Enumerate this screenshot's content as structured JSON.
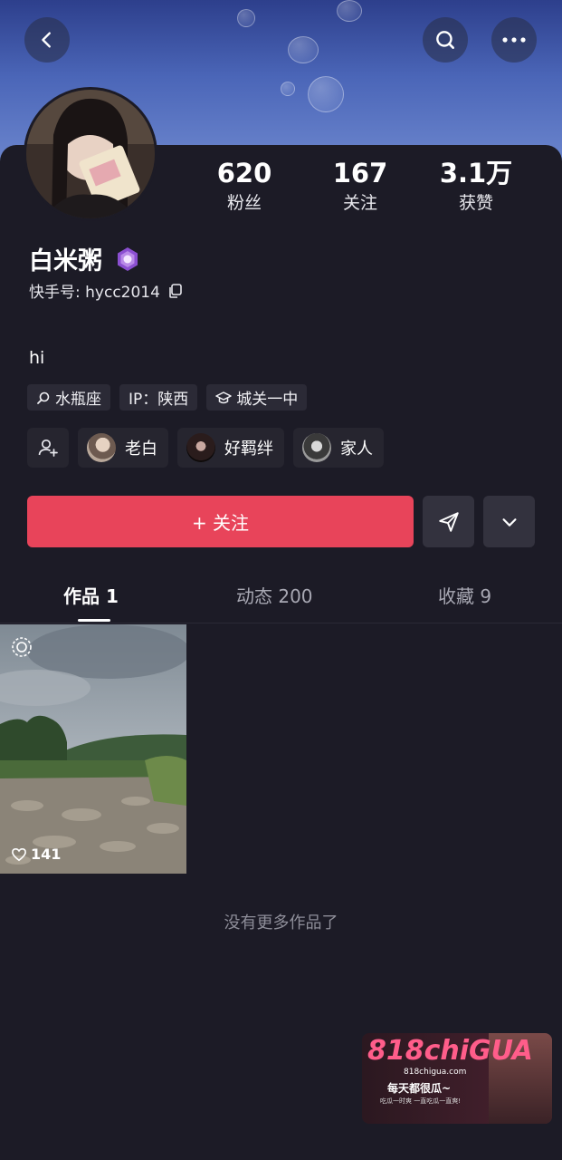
{
  "profile": {
    "name": "白米粥",
    "user_id": "快手号: hycc2014",
    "bio": "hi"
  },
  "stats": [
    {
      "value": "620",
      "label": "粉丝"
    },
    {
      "value": "167",
      "label": "关注"
    },
    {
      "value": "3.1万",
      "label": "获赞"
    }
  ],
  "tags": [
    {
      "icon": "search-icon",
      "label": "水瓶座"
    },
    {
      "icon": "",
      "label": "IP：陕西"
    },
    {
      "icon": "graduation-cap-icon",
      "label": "城关一中"
    }
  ],
  "friends": [
    {
      "name": "老白"
    },
    {
      "name": "好羁绊"
    },
    {
      "name": "家人"
    }
  ],
  "actions": {
    "follow_label": "+ 关注"
  },
  "tabs": [
    {
      "label": "作品 1",
      "active": true
    },
    {
      "label": "动态 200",
      "active": false
    },
    {
      "label": "收藏 9",
      "active": false
    }
  ],
  "works": [
    {
      "likes": "141"
    }
  ],
  "footer": {
    "no_more": "没有更多作品了"
  },
  "watermark": {
    "logo": "818chiGUA",
    "site": "818chigua.com",
    "slogan": "每天都很瓜~",
    "sub": "吃瓜一时爽 一直吃瓜一直爽!"
  },
  "colors": {
    "accent": "#e8445a",
    "background": "#1c1b26"
  }
}
